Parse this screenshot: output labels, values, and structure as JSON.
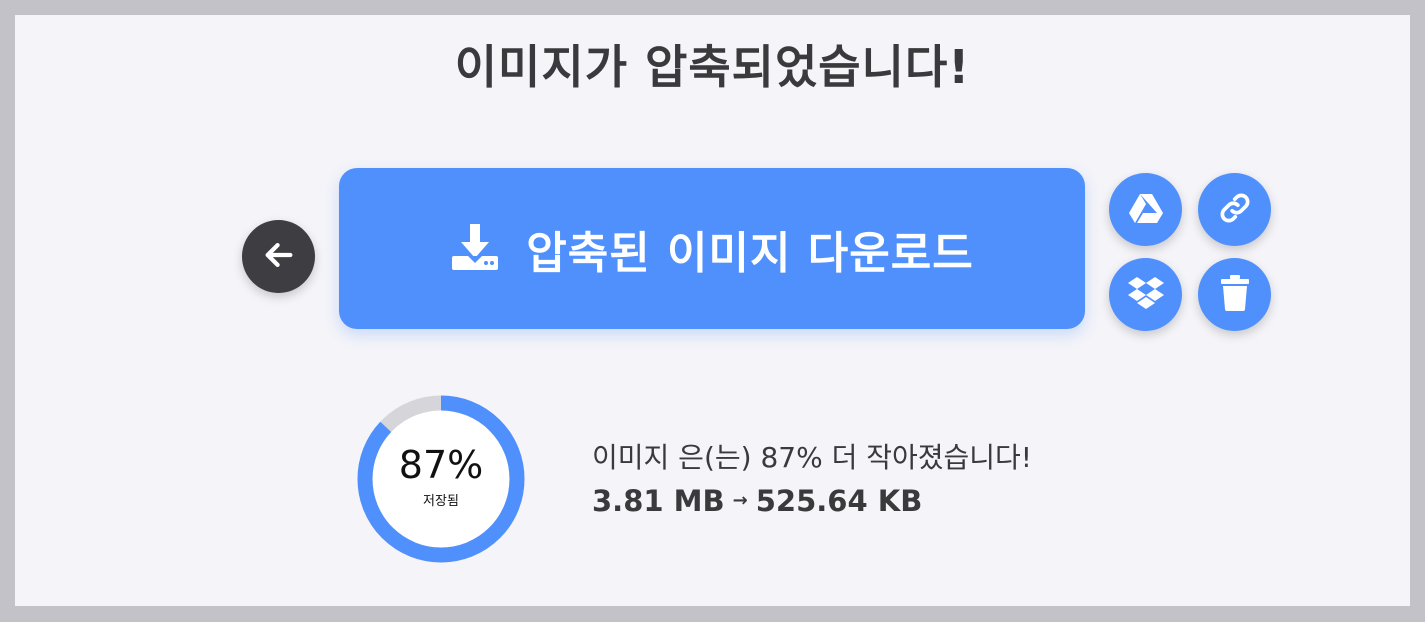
{
  "title": "이미지가 압축되었습니다!",
  "download_button": {
    "label": "압축된 이미지 다운로드"
  },
  "result": {
    "percent_label": "87%",
    "saved_label": "저장됨",
    "saved_fraction": 0.87,
    "message": "이미지 은(는) 87% 더 작아졌습니다!",
    "original_size": "3.81 MB",
    "arrow": "→",
    "compressed_size": "525.64 KB"
  },
  "colors": {
    "accent": "#5090fd",
    "back_button": "#3e3d41",
    "ring_track": "#d6d6da",
    "panel_bg": "#f4f4f9"
  },
  "icons": {
    "back": "arrow-left-icon",
    "download": "download-icon",
    "google_drive": "google-drive-icon",
    "link": "link-icon",
    "dropbox": "dropbox-icon",
    "trash": "trash-icon"
  }
}
